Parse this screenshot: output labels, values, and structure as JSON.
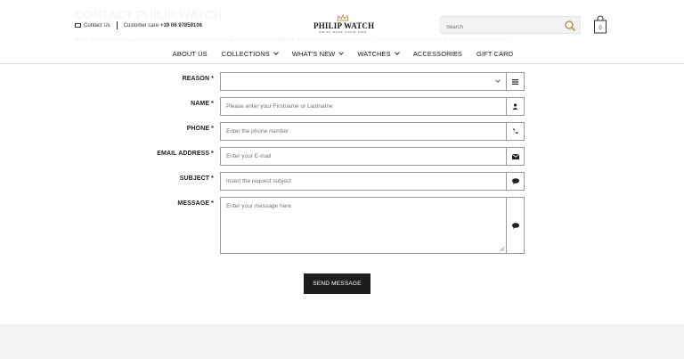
{
  "header": {
    "ghost_title": "CONTACT PHILIP WATCH",
    "ghost_text": "We are at your complete disposal for any kind of information, send us a message or call us at +39 06 97859106, available from Monday to Friday, 9:00 - 18:00. Alternatively, you can send us an email using the form below.",
    "contact_label": "Contact Us",
    "care_label": "Customer care",
    "care_phone": "+39 06 97859106",
    "logo_brand": "PHILIP WATCH",
    "logo_tag": "SWISS MADE SINCE 1858",
    "search_placeholder": "Search",
    "bag_count": "0"
  },
  "nav": {
    "items": [
      {
        "label": "ABOUT US",
        "has_dropdown": false
      },
      {
        "label": "COLLECTIONS",
        "has_dropdown": true
      },
      {
        "label": "WHAT'S NEW",
        "has_dropdown": true
      },
      {
        "label": "WATCHES",
        "has_dropdown": true
      },
      {
        "label": "ACCESSORIES",
        "has_dropdown": false
      },
      {
        "label": "GIFT CARD",
        "has_dropdown": false
      }
    ]
  },
  "form": {
    "reason": {
      "label": "REASON *",
      "value": "",
      "icon": "list-icon"
    },
    "name": {
      "label": "NAME *",
      "placeholder": "Please enter your Firstname or Lastname",
      "icon": "user-icon"
    },
    "phone": {
      "label": "PHONE *",
      "placeholder": "Enter the phone number",
      "icon": "phone-icon"
    },
    "email": {
      "label": "EMAIL ADDRESS *",
      "placeholder": "Enter your E-mail",
      "icon": "envelope-icon"
    },
    "subject": {
      "label": "SUBJECT *",
      "placeholder": "Insert the request subject",
      "icon": "comment-icon"
    },
    "message": {
      "label": "MESSAGE *",
      "placeholder": "Enter your message here",
      "icon": "comment-icon"
    },
    "send_label": "SEND MESSAGE"
  },
  "colors": {
    "accent_gold": "#b8955a",
    "button_bg": "#1d1d1d",
    "border": "#9a9a9a",
    "footer_bg": "#f2f2f2"
  }
}
